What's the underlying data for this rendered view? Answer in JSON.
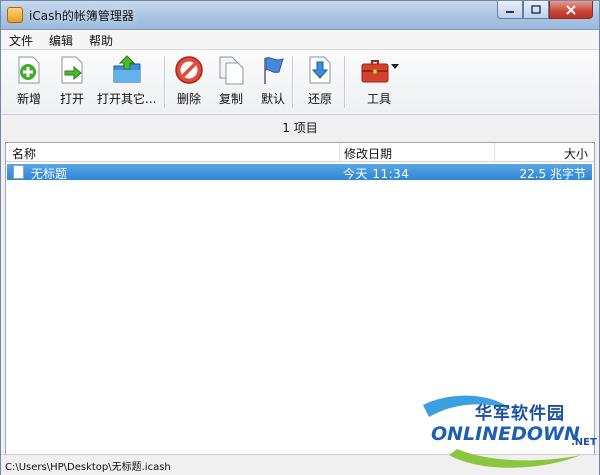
{
  "window": {
    "title": "iCash的帐簿管理器"
  },
  "menu": {
    "items": [
      "文件",
      "编辑",
      "帮助"
    ]
  },
  "toolbar": {
    "new": "新增",
    "open": "打开",
    "open_other": "打开其它...",
    "delete": "删除",
    "copy": "复制",
    "default": "默认",
    "restore": "还原",
    "tools": "工具"
  },
  "count_text": "1 项目",
  "list": {
    "columns": {
      "name": "名称",
      "modified": "修改日期",
      "size": "大小"
    },
    "rows": [
      {
        "name": "无标题",
        "modified": "今天 11:34",
        "size": "22.5 兆字节"
      }
    ]
  },
  "status": {
    "path": "C:\\Users\\HP\\Desktop\\无标题.icash"
  },
  "watermark": {
    "cn": "华军软件园",
    "en": "ONLINEDOWN",
    "suffix": ".NET"
  },
  "colors": {
    "selection": "#3b8fd9",
    "title_bar": "#b6cce6",
    "close_button": "#c9463a"
  }
}
